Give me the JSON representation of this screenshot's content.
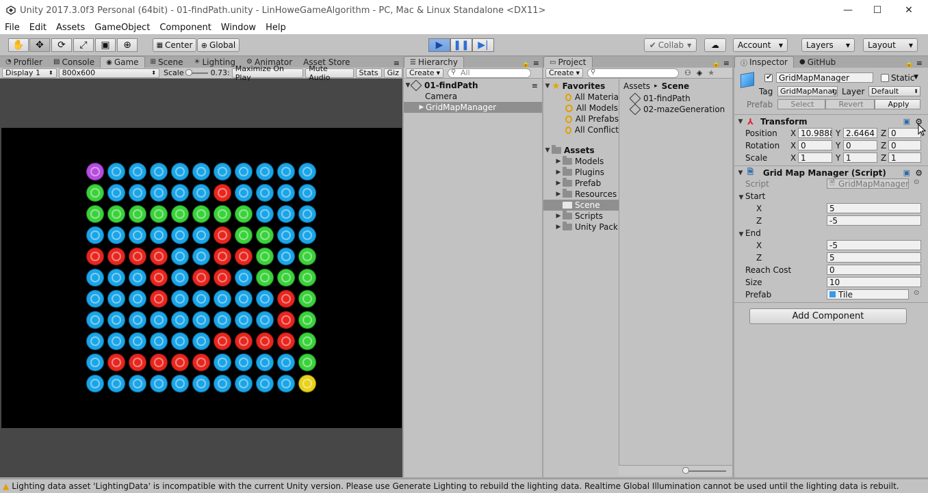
{
  "window": {
    "title": "Unity 2017.3.0f3 Personal (64bit) - 01-findPath.unity - LinHoweGameAlgorithm - PC, Mac & Linux Standalone <DX11>",
    "minimize_glyph": "—",
    "maximize_glyph": "☐",
    "close_glyph": "✕"
  },
  "menu": [
    "File",
    "Edit",
    "Assets",
    "GameObject",
    "Component",
    "Window",
    "Help"
  ],
  "toolbar": {
    "tools": [
      "hand-icon",
      "move-icon",
      "rotate-icon",
      "scale-icon",
      "rect-icon",
      "transform-icon"
    ],
    "pivot": "Center",
    "space": "Global",
    "collab": "Collab",
    "account": "Account",
    "layers": "Layers",
    "layout": "Layout"
  },
  "left_tabs": [
    "Profiler",
    "Console",
    "Game",
    "Scene",
    "Lighting",
    "Animator",
    "Asset Store"
  ],
  "game_bar": {
    "display": "Display 1",
    "resolution": "800x600",
    "scale_label": "Scale",
    "scale_value": "0.73:",
    "maximize": "Maximize On Play",
    "mute": "Mute Audio",
    "stats": "Stats",
    "gizmos": "Giz"
  },
  "grid": {
    "rows": [
      "pbbbbbbbbbb",
      "gbbbbbrbbbb",
      "ggggggggbbb",
      "bbbbbbrggbb",
      "rrrrbbrrgbg",
      "bbbrbrrbggg",
      "bbbrbbbbbrg",
      "bbbbbbbbbrg",
      "bbbbbbrrrrg",
      "brrrrrbbbbg",
      "bbbbbbbbbby"
    ],
    "colors": {
      "b": "#1aa5e8",
      "g": "#3ad23a",
      "r": "#e8261e",
      "p": "#b84ce0",
      "y": "#e8d21a"
    }
  },
  "hierarchy": {
    "tab": "Hierarchy",
    "create": "Create",
    "search_placeholder": "All",
    "scene": "01-findPath",
    "items": [
      "Camera",
      "GridMapManager"
    ]
  },
  "project": {
    "tab": "Project",
    "create": "Create",
    "favorites_label": "Favorites",
    "favorites": [
      "All Materia",
      "All Models",
      "All Prefabs",
      "All Conflict"
    ],
    "assets_label": "Assets",
    "folders": [
      "Models",
      "Plugins",
      "Prefab",
      "Resources",
      "Scene",
      "Scripts",
      "Unity Pack"
    ],
    "breadcrumb_root": "Assets",
    "breadcrumb_sep": "▸",
    "breadcrumb_current": "Scene",
    "files": [
      "01-findPath",
      "02-mazeGeneration"
    ]
  },
  "inspector": {
    "tabs": [
      "Inspector",
      "GitHub"
    ],
    "object_name": "GridMapManager",
    "static_label": "Static",
    "tag_label": "Tag",
    "tag_value": "GridMapManag",
    "layer_label": "Layer",
    "layer_value": "Default",
    "prefab_label": "Prefab",
    "prefab_select": "Select",
    "prefab_revert": "Revert",
    "prefab_apply": "Apply",
    "transform": {
      "title": "Transform",
      "position_label": "Position",
      "position": [
        "10.9888",
        "2.6464",
        "0"
      ],
      "rotation_label": "Rotation",
      "rotation": [
        "0",
        "0",
        "0"
      ],
      "scale_label": "Scale",
      "scale": [
        "1",
        "1",
        "1"
      ],
      "x": "X",
      "y": "Y",
      "z": "Z"
    },
    "script_component": {
      "title": "Grid Map Manager (Script)",
      "script_label": "Script",
      "script_value": "GridMapManager",
      "start_label": "Start",
      "start_x": "5",
      "start_z": "-5",
      "end_label": "End",
      "end_x": "-5",
      "end_z": "5",
      "reach_cost_label": "Reach Cost",
      "reach_cost": "0",
      "size_label": "Size",
      "size": "10",
      "prefab_label": "Prefab",
      "prefab_value": "Tile",
      "x": "X",
      "z": "Z"
    },
    "add_component": "Add Component"
  },
  "status": "Lighting data asset 'LightingData' is incompatible with the current Unity version. Please use Generate Lighting to rebuild the lighting data.  Realtime Global Illumination cannot be used until the lighting data is rebuilt."
}
